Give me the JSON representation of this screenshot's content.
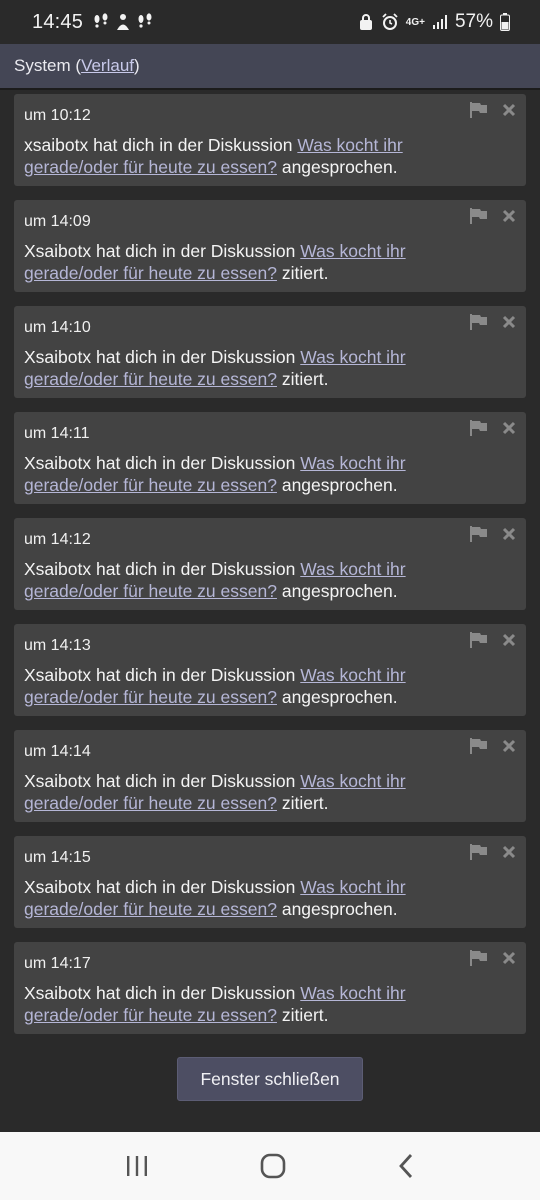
{
  "status_bar": {
    "time": "14:45",
    "network": "4G+",
    "battery": "57%"
  },
  "header": {
    "title": "System",
    "history_link": "Verlauf"
  },
  "notifications": [
    {
      "time": "um 10:12",
      "user": "xsaibotx",
      "middle": " hat dich in der Diskussion ",
      "link": "Was kocht ihr gerade/oder für heute zu essen?",
      "action": " angesprochen."
    },
    {
      "time": "um 14:09",
      "user": "Xsaibotx",
      "middle": " hat dich in der Diskussion ",
      "link": "Was kocht ihr gerade/oder für heute zu essen?",
      "action": " zitiert."
    },
    {
      "time": "um 14:10",
      "user": "Xsaibotx",
      "middle": " hat dich in der Diskussion ",
      "link": "Was kocht ihr gerade/oder für heute zu essen?",
      "action": " zitiert."
    },
    {
      "time": "um 14:11",
      "user": "Xsaibotx",
      "middle": " hat dich in der Diskussion ",
      "link": "Was kocht ihr gerade/oder für heute zu essen?",
      "action": " angesprochen."
    },
    {
      "time": "um 14:12",
      "user": "Xsaibotx",
      "middle": " hat dich in der Diskussion ",
      "link": "Was kocht ihr gerade/oder für heute zu essen?",
      "action": " angesprochen."
    },
    {
      "time": "um 14:13",
      "user": "Xsaibotx",
      "middle": " hat dich in der Diskussion ",
      "link": "Was kocht ihr gerade/oder für heute zu essen?",
      "action": " angesprochen."
    },
    {
      "time": "um 14:14",
      "user": "Xsaibotx",
      "middle": " hat dich in der Diskussion ",
      "link": "Was kocht ihr gerade/oder für heute zu essen?",
      "action": " zitiert."
    },
    {
      "time": "um 14:15",
      "user": "Xsaibotx",
      "middle": " hat dich in der Diskussion ",
      "link": "Was kocht ihr gerade/oder für heute zu essen?",
      "action": " angesprochen."
    },
    {
      "time": "um 14:17",
      "user": "Xsaibotx",
      "middle": " hat dich in der Diskussion ",
      "link": "Was kocht ihr gerade/oder für heute zu essen?",
      "action": " zitiert."
    }
  ],
  "close_button": "Fenster schließen",
  "colors": {
    "background": "#2a2a2a",
    "header": "#444655",
    "card": "#434343",
    "link": "#b5b6d6",
    "button": "#4d4e63"
  }
}
